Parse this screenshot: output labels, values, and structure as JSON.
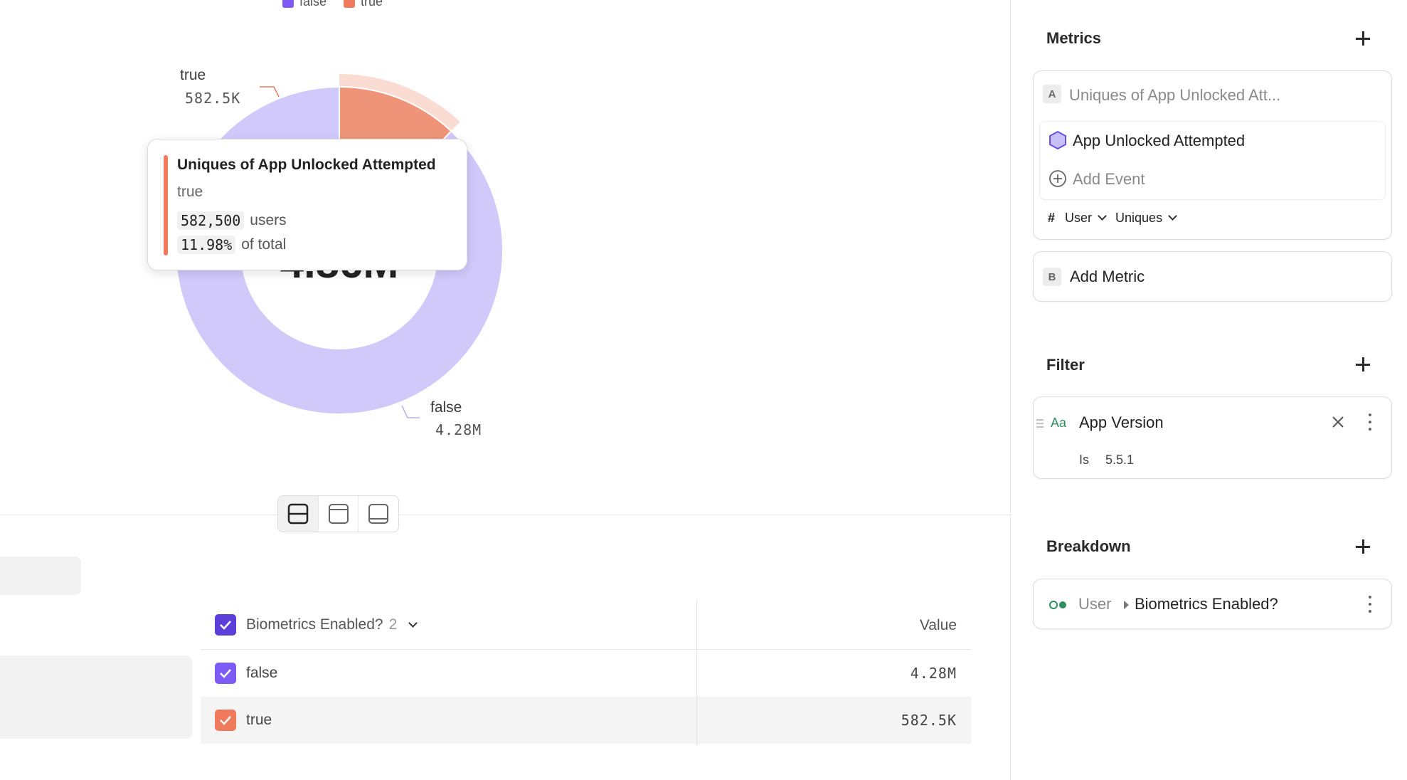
{
  "legend": [
    {
      "label": "false",
      "color": "#7c5cf5"
    },
    {
      "label": "true",
      "color": "#ef7a5c"
    }
  ],
  "chart_data": {
    "type": "pie",
    "title": "",
    "center_label": "4.86M",
    "slices": [
      {
        "label": "false",
        "value": 4280000,
        "display": "4.28M",
        "color": "#d2c9fb"
      },
      {
        "label": "true",
        "value": 582500,
        "display": "582.5K",
        "color": "#ef9479",
        "highlight_color": "#fbdcd2"
      }
    ]
  },
  "slice_labels": {
    "true_label": "true",
    "true_value": "582.5K",
    "false_label": "false",
    "false_value": "4.28M"
  },
  "tooltip": {
    "title": "Uniques of App Unlocked Attempted",
    "segment": "true",
    "count": "582,500",
    "count_unit": "users",
    "percent": "11.98%",
    "percent_unit": "of total",
    "accent_color": "#ef7a5c"
  },
  "table": {
    "segment_header": "Biometrics Enabled?",
    "segment_count": "2",
    "value_header": "Value",
    "rows": [
      {
        "label": "false",
        "value": "4.28M",
        "color": "#7c5cf5"
      },
      {
        "label": "true",
        "value": "582.5K",
        "color": "#ef7a5c"
      }
    ],
    "header_checkbox_color": "#5b3fd8"
  },
  "sidebar": {
    "metrics": {
      "title": "Metrics",
      "metric_a": {
        "letter": "A",
        "name": "Uniques of App Unlocked Att...",
        "event": "App Unlocked Attempted",
        "add_event": "Add Event",
        "measure_symbol": "#",
        "measure_entity": "User",
        "measure_type": "Uniques"
      },
      "metric_b": {
        "letter": "B",
        "name": "Add Metric"
      }
    },
    "filter": {
      "title": "Filter",
      "type_badge": "Aa",
      "property": "App Version",
      "operator": "Is",
      "value": "5.5.1"
    },
    "breakdown": {
      "title": "Breakdown",
      "entity": "User",
      "property": "Biometrics Enabled?"
    }
  }
}
